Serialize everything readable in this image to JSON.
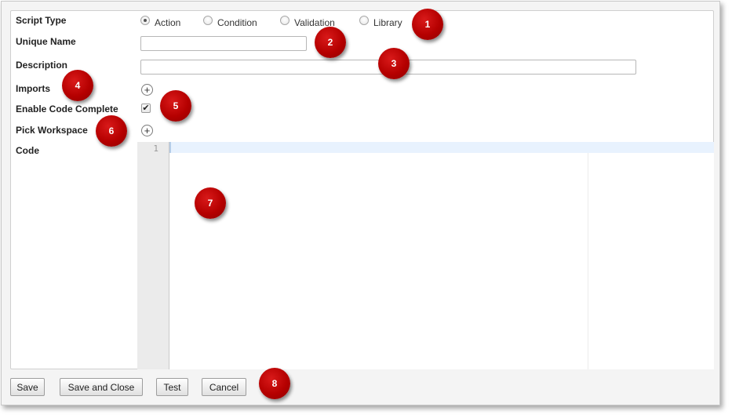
{
  "form": {
    "script_type_label": "Script Type",
    "script_type_options": [
      "Action",
      "Condition",
      "Validation",
      "Library"
    ],
    "script_type_selected": "Action",
    "unique_name_label": "Unique Name",
    "unique_name_value": "",
    "description_label": "Description",
    "description_value": "",
    "imports_label": "Imports",
    "enable_code_complete_label": "Enable Code Complete",
    "enable_code_complete_checked": true,
    "pick_workspace_label": "Pick Workspace",
    "code_label": "Code"
  },
  "editor": {
    "line_numbers": [
      "1"
    ],
    "content": ""
  },
  "buttons": {
    "save": "Save",
    "save_and_close": "Save and Close",
    "test": "Test",
    "cancel": "Cancel"
  },
  "callouts": [
    "1",
    "2",
    "3",
    "4",
    "5",
    "6",
    "7",
    "8"
  ],
  "colors": {
    "callout": "#b50000",
    "active_line": "#e8f2fe",
    "gutter": "#ebebeb"
  },
  "icons": {
    "add": "plus-circle-icon",
    "check": "check-icon"
  }
}
